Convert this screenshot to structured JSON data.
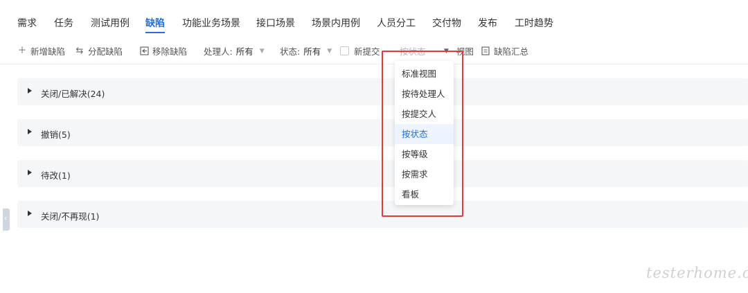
{
  "tabs": [
    {
      "label": "需求"
    },
    {
      "label": "任务"
    },
    {
      "label": "测试用例"
    },
    {
      "label": "缺陷",
      "active": true
    },
    {
      "label": "功能业务场景"
    },
    {
      "label": "接口场景"
    },
    {
      "label": "场景内用例"
    },
    {
      "label": "人员分工"
    },
    {
      "label": "交付物"
    },
    {
      "label": "发布"
    },
    {
      "label": "工时趋势"
    }
  ],
  "toolbar": {
    "add_bug": "新增缺陷",
    "assign_bug": "分配缺陷",
    "remove_bug": "移除缺陷",
    "handler_label": "处理人:",
    "handler_value": "所有",
    "status_label": "状态:",
    "status_value": "所有",
    "new_submit_label": "新提交",
    "view_selector_label": "按状态",
    "view_label": "视图",
    "bug_summary": "缺陷汇总"
  },
  "groups": [
    {
      "label": "关闭/已解决(24)"
    },
    {
      "label": "撤销(5)"
    },
    {
      "label": "待改(1)"
    },
    {
      "label": "关闭/不再现(1)"
    }
  ],
  "dropdown": {
    "items": [
      {
        "label": "标准视图"
      },
      {
        "label": "按待处理人"
      },
      {
        "label": "按提交人"
      },
      {
        "label": "按状态",
        "selected": true
      },
      {
        "label": "按等级"
      },
      {
        "label": "按需求"
      },
      {
        "label": "看板"
      }
    ]
  },
  "colors": {
    "accent": "#1e6fe0",
    "highlight": "#e53935",
    "group_bg": "#f5f6f8"
  },
  "watermark": "testerhome.com"
}
